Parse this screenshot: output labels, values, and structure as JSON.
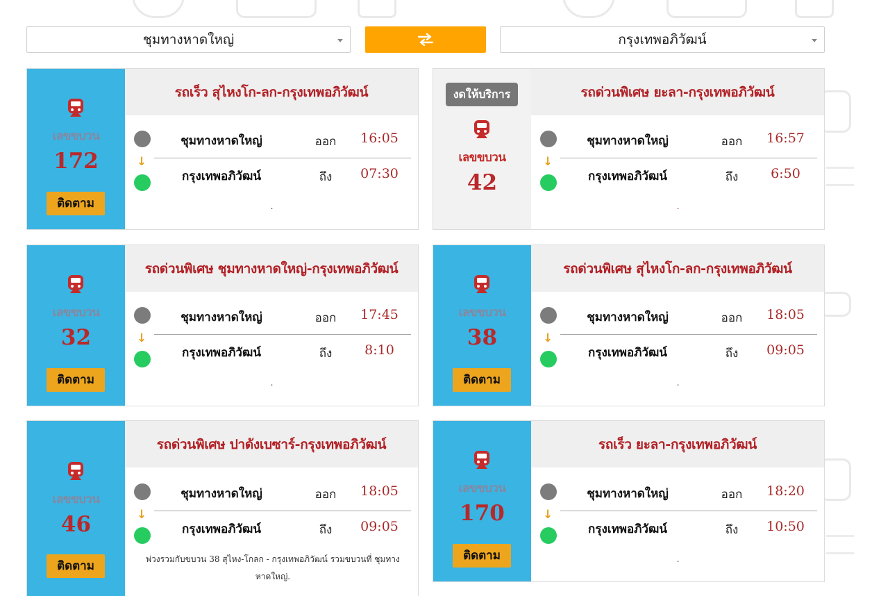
{
  "search": {
    "from_station": "ชุมทางหาดใหญ่",
    "to_station": "กรุงเทพอภิวัฒน์",
    "swap_icon": "swap-arrows-icon"
  },
  "labels": {
    "train_number": "เลขขบวน",
    "follow_button": "ติดตาม",
    "depart": "ออก",
    "arrive": "ถึง"
  },
  "colors": {
    "side_panel": "#3ab4e2",
    "accent_button": "#ffa400",
    "follow_button": "#eda51e",
    "title_red": "#b22025",
    "time_red": "#a82a2a",
    "origin_dot": "#7c7c7c",
    "destination_dot": "#27cc61",
    "suspended_badge": "#777777"
  },
  "trains": [
    {
      "title": "รถเร็ว สุไหงโก-ลก-กรุงเทพอภิวัฒน์",
      "number": "172",
      "origin": "ชุมทางหาดใหญ่",
      "depart_time": "16:05",
      "destination": "กรุงเทพอภิวัฒน์",
      "arrive_time": "07:30",
      "note": "."
    },
    {
      "title": "รถด่วนพิเศษ ยะลา-กรุงเทพอภิวัฒน์",
      "number": "42",
      "status": "งดให้บริการ",
      "origin": "ชุมทางหาดใหญ่",
      "depart_time": "16:57",
      "destination": "กรุงเทพอภิวัฒน์",
      "arrive_time": "6:50",
      "note": "."
    },
    {
      "title": "รถด่วนพิเศษ ชุมทางหาดใหญ่-กรุงเทพอภิวัฒน์",
      "number": "32",
      "origin": "ชุมทางหาดใหญ่",
      "depart_time": "17:45",
      "destination": "กรุงเทพอภิวัฒน์",
      "arrive_time": "8:10",
      "note": "."
    },
    {
      "title": "รถด่วนพิเศษ สุไหงโก-ลก-กรุงเทพอภิวัฒน์",
      "number": "38",
      "origin": "ชุมทางหาดใหญ่",
      "depart_time": "18:05",
      "destination": "กรุงเทพอภิวัฒน์",
      "arrive_time": "09:05",
      "note": "."
    },
    {
      "title": "รถด่วนพิเศษ ปาดังเบซาร์-กรุงเทพอภิวัฒน์",
      "number": "46",
      "origin": "ชุมทางหาดใหญ่",
      "depart_time": "18:05",
      "destination": "กรุงเทพอภิวัฒน์",
      "arrive_time": "09:05",
      "note": "พ่วงรวมกับขบวน 38 สุไหง-โกลก - กรุงเทพอภิวัฒน์ รวมขบวนที่ ชุมทางหาดใหญ่."
    },
    {
      "title": "รถเร็ว ยะลา-กรุงเทพอภิวัฒน์",
      "number": "170",
      "origin": "ชุมทางหาดใหญ่",
      "depart_time": "18:20",
      "destination": "กรุงเทพอภิวัฒน์",
      "arrive_time": "10:50",
      "note": "."
    }
  ]
}
